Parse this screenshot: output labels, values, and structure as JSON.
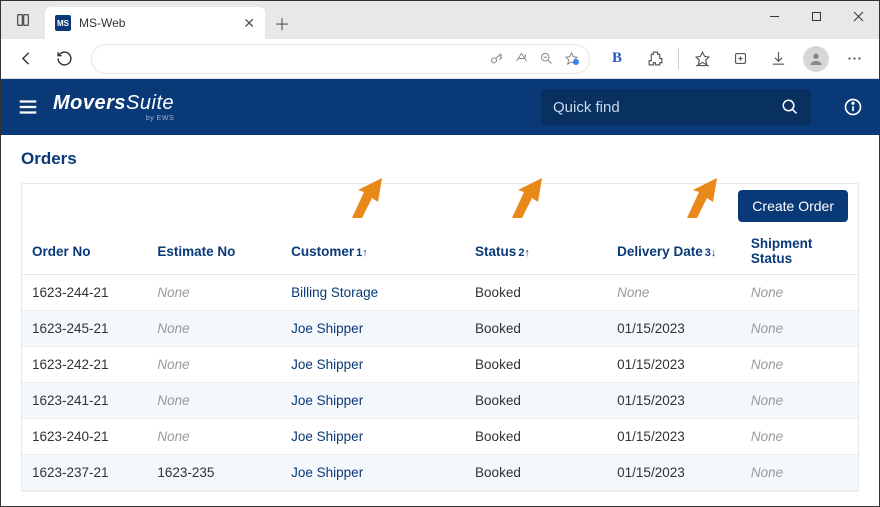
{
  "browser": {
    "tab_title": "MS-Web",
    "favicon_text": "MS"
  },
  "app_header": {
    "brand1": "Movers",
    "brand2": "Suite",
    "brand_sub": "by EWS",
    "search_placeholder": "Quick find"
  },
  "page": {
    "title": "Orders",
    "create_label": "Create Order"
  },
  "columns": {
    "order_no": "Order No",
    "estimate_no": "Estimate No",
    "customer": "Customer",
    "customer_sort": "1↑",
    "status": "Status",
    "status_sort": "2↑",
    "delivery": "Delivery Date",
    "delivery_sort": "3↓",
    "shipment": "Shipment Status"
  },
  "rows": [
    {
      "order": "1623-244-21",
      "est": "None",
      "cust": "Billing Storage",
      "status": "Booked",
      "date": "None",
      "ship": "None"
    },
    {
      "order": "1623-245-21",
      "est": "None",
      "cust": "Joe Shipper",
      "status": "Booked",
      "date": "01/15/2023",
      "ship": "None"
    },
    {
      "order": "1623-242-21",
      "est": "None",
      "cust": "Joe Shipper",
      "status": "Booked",
      "date": "01/15/2023",
      "ship": "None"
    },
    {
      "order": "1623-241-21",
      "est": "None",
      "cust": "Joe Shipper",
      "status": "Booked",
      "date": "01/15/2023",
      "ship": "None"
    },
    {
      "order": "1623-240-21",
      "est": "None",
      "cust": "Joe Shipper",
      "status": "Booked",
      "date": "01/15/2023",
      "ship": "None"
    },
    {
      "order": "1623-237-21",
      "est": "1623-235",
      "cust": "Joe Shipper",
      "status": "Booked",
      "date": "01/15/2023",
      "ship": "None"
    }
  ]
}
